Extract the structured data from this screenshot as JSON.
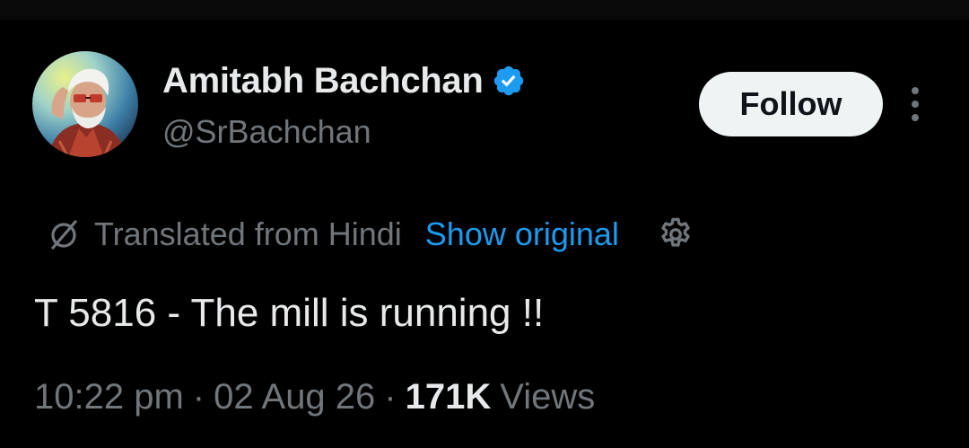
{
  "author": {
    "name": "Amitabh Bachchan",
    "handle": "@SrBachchan",
    "verified": true
  },
  "follow_button": {
    "label": "Follow"
  },
  "translation": {
    "label": "Translated from Hindi",
    "show_original_label": "Show original"
  },
  "tweet": {
    "text": "T 5816 - The mill is running !!"
  },
  "meta": {
    "time": "10:22 pm",
    "separator": "·",
    "date": "02 Aug 26",
    "views_count": "171K",
    "views_label": "Views"
  },
  "icons": {
    "verified": "verified-badge-icon",
    "more": "more-vertical-icon",
    "translate": "translate-icon",
    "settings": "gear-icon"
  },
  "colors": {
    "background": "#000000",
    "primary_text": "#e7e9ea",
    "secondary_text": "#71767b",
    "accent_blue": "#1d9bf0",
    "button_bg": "#eff3f4",
    "button_text": "#0f1419"
  }
}
